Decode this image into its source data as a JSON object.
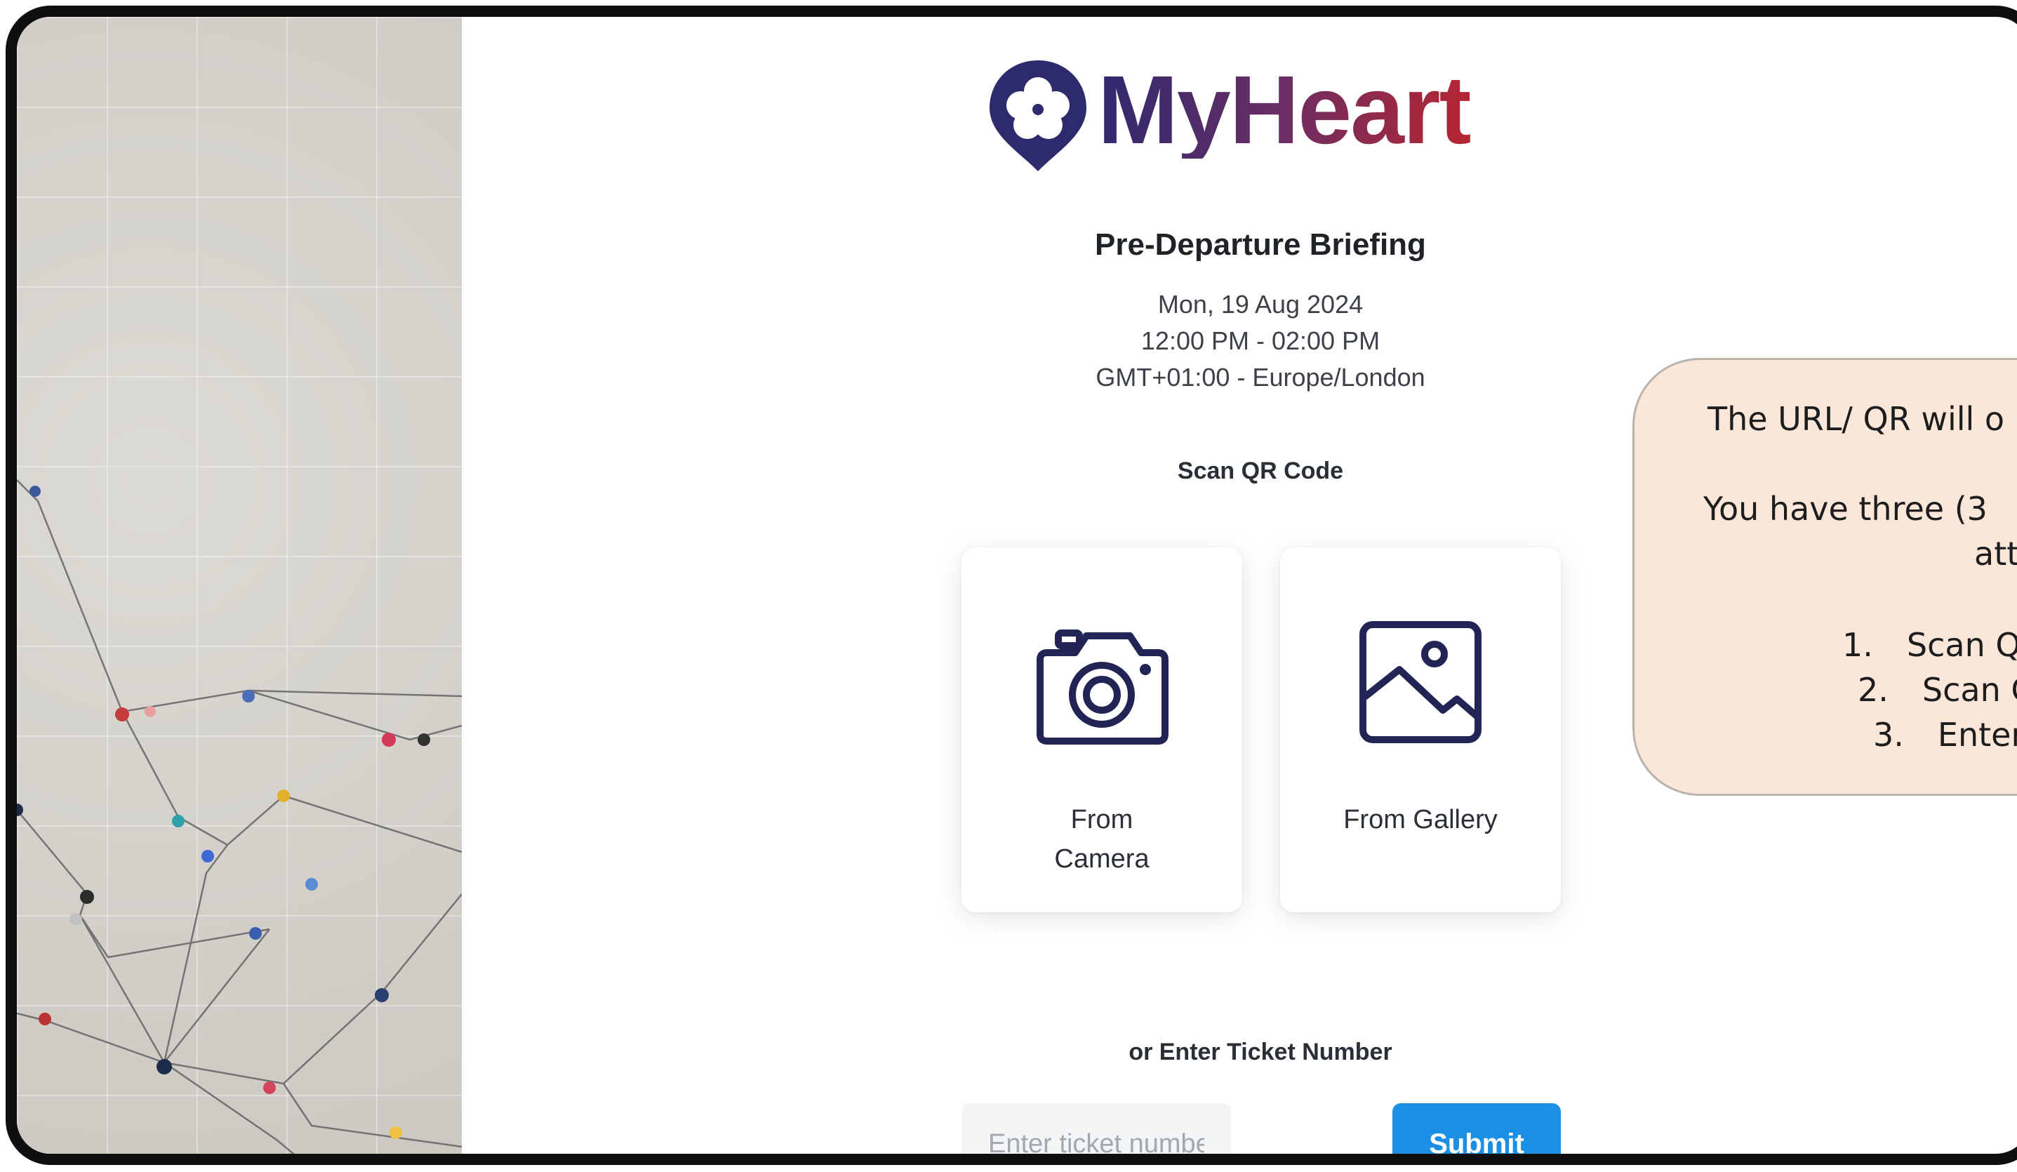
{
  "brand": {
    "name": "MyHeart",
    "colors": {
      "navy": "#2e2a6e",
      "plum": "#6c2d63",
      "red": "#b62631"
    }
  },
  "event": {
    "title": "Pre-Departure Briefing",
    "date": "Mon, 19 Aug 2024",
    "time": "12:00 PM - 02:00 PM",
    "timezone": "GMT+01:00 - Europe/London"
  },
  "scan": {
    "label": "Scan QR Code",
    "camera": {
      "label": "From Camera",
      "icon": "camera-icon"
    },
    "gallery": {
      "label": "From Gallery",
      "icon": "image-icon"
    }
  },
  "ticket": {
    "label": "or Enter Ticket Number",
    "placeholder": "Enter ticket number",
    "submit_label": "Submit",
    "accent": "#1a8fe3"
  },
  "callout": {
    "line1": "The URL/ QR will o",
    "line2": "You have three (3",
    "line2b": "atte",
    "items": [
      {
        "num": "1.",
        "text": "Scan Q"
      },
      {
        "num": "2.",
        "text": "Scan C"
      },
      {
        "num": "3.",
        "text": "Enter"
      }
    ],
    "background": "#fbe6da"
  }
}
